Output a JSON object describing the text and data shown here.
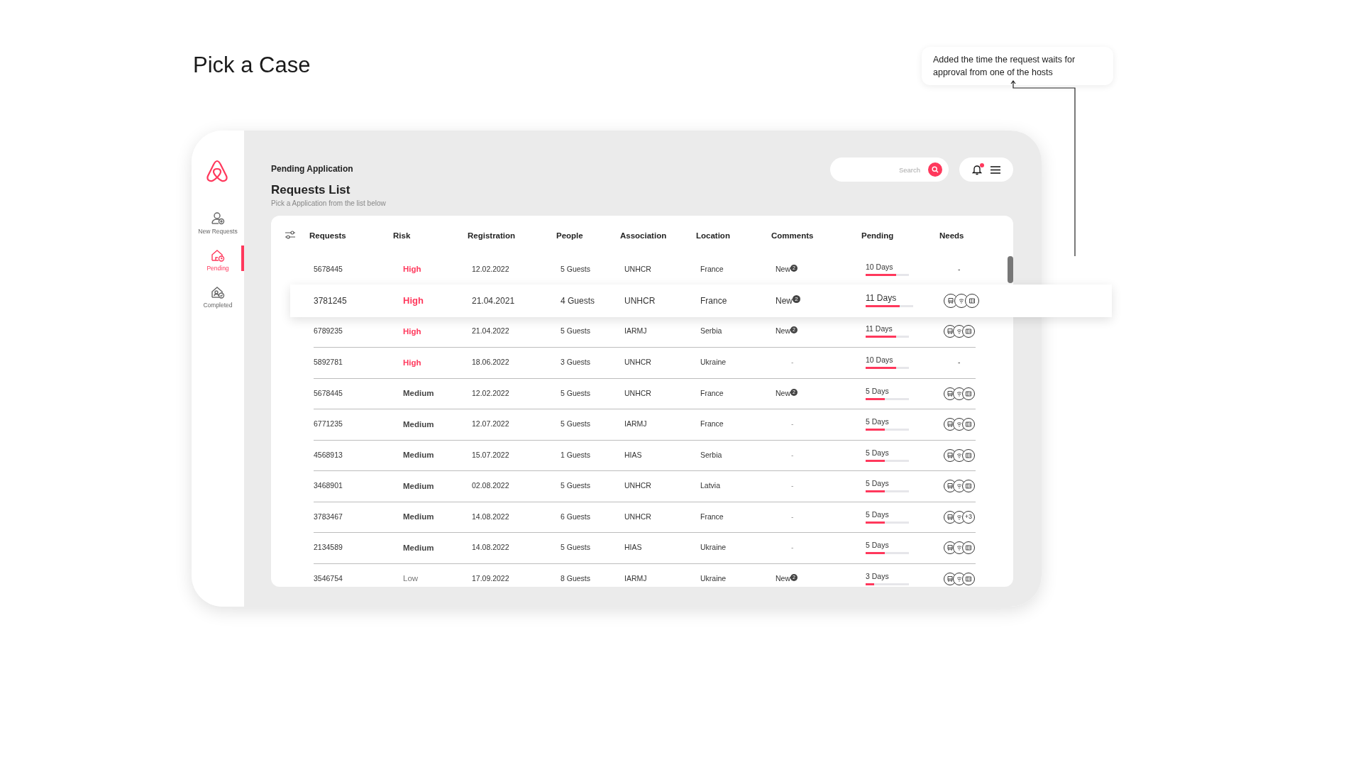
{
  "page_title": "Pick a Case",
  "annotation": {
    "text": "Added the time the request waits for approval from one of the hosts"
  },
  "sidebar": {
    "items": [
      {
        "label": "New Requests",
        "selected": false
      },
      {
        "label": "Pending",
        "selected": true
      },
      {
        "label": "Completed",
        "selected": false
      }
    ]
  },
  "header": {
    "eyebrow": "Pending Application",
    "title": "Requests List",
    "subtitle": "Pick a Application from the list below"
  },
  "search": {
    "placeholder": "Search"
  },
  "notifications": {
    "unread": true
  },
  "table": {
    "columns": [
      "Requests",
      "Risk",
      "Registration",
      "People",
      "Association",
      "Location",
      "Comments",
      "Pending",
      "Needs"
    ],
    "rows": [
      {
        "request": "5678445",
        "risk": "High",
        "color": "#ff385c",
        "risk_bold": true,
        "registration": "12.02.2022",
        "people": "5 Guests",
        "association": "UNHCR",
        "location": "France",
        "comment": "New",
        "comment_badge": "2",
        "pending": "10 Days",
        "level": 0.7,
        "needs_text": "-",
        "selected": false
      },
      {
        "request": "3781245",
        "risk": "High",
        "color": "#ff385c",
        "risk_bold": true,
        "registration": "21.04.2021",
        "people": "4 Guests",
        "association": "UNHCR",
        "location": "France",
        "comment": "New",
        "comment_badge": "2",
        "pending": "11 Days",
        "level": 0.72,
        "needs": [
          {
            "kind": "seat"
          },
          {
            "kind": "wifi"
          },
          {
            "kind": "card"
          }
        ],
        "selected": true
      },
      {
        "request": "6789235",
        "risk": "High",
        "color": "#ff385c",
        "risk_bold": true,
        "registration": "21.04.2022",
        "people": "5 Guests",
        "association": "IARMJ",
        "location": "Serbia",
        "comment": "New",
        "comment_badge": "2",
        "pending": "11 Days",
        "level": 0.71,
        "needs": [
          {
            "kind": "seat"
          },
          {
            "kind": "wifi"
          },
          {
            "kind": "card"
          }
        ],
        "selected": false
      },
      {
        "request": "5892781",
        "risk": "High",
        "color": "#ff385c",
        "risk_bold": true,
        "registration": "18.06.2022",
        "people": "3 Guests",
        "association": "UNHCR",
        "location": "Ukraine",
        "comment": "-",
        "pending": "10 Days",
        "level": 0.7,
        "needs_text": "-",
        "selected": false
      },
      {
        "request": "5678445",
        "risk": "Medium",
        "color": "#444444",
        "risk_bold": true,
        "registration": "12.02.2022",
        "people": "5 Guests",
        "association": "UNHCR",
        "location": "France",
        "comment": "New",
        "comment_badge": "2",
        "pending": "5 Days",
        "level": 0.44,
        "needs": [
          {
            "kind": "seat"
          },
          {
            "kind": "wifi"
          },
          {
            "kind": "card"
          }
        ],
        "selected": false
      },
      {
        "request": "6771235",
        "risk": "Medium",
        "color": "#444444",
        "risk_bold": true,
        "registration": "12.07.2022",
        "people": "5 Guests",
        "association": "IARMJ",
        "location": "France",
        "comment": "-",
        "pending": "5 Days",
        "level": 0.44,
        "needs": [
          {
            "kind": "seat"
          },
          {
            "kind": "wifi"
          },
          {
            "kind": "card"
          }
        ],
        "selected": false
      },
      {
        "request": "4568913",
        "risk": "Medium",
        "color": "#444444",
        "risk_bold": true,
        "registration": "15.07.2022",
        "people": "1 Guests",
        "association": "HIAS",
        "location": "Serbia",
        "comment": "-",
        "pending": "5 Days",
        "level": 0.44,
        "needs": [
          {
            "kind": "seat"
          },
          {
            "kind": "wifi"
          },
          {
            "kind": "card"
          }
        ],
        "selected": false
      },
      {
        "request": "3468901",
        "risk": "Medium",
        "color": "#444444",
        "risk_bold": true,
        "registration": "02.08.2022",
        "people": "5 Guests",
        "association": "UNHCR",
        "location": "Latvia",
        "comment": "-",
        "pending": "5 Days",
        "level": 0.44,
        "needs": [
          {
            "kind": "seat"
          },
          {
            "kind": "wifi"
          },
          {
            "kind": "card"
          }
        ],
        "selected": false
      },
      {
        "request": "3783467",
        "risk": "Medium",
        "color": "#444444",
        "risk_bold": true,
        "registration": "14.08.2022",
        "people": "6 Guests",
        "association": "UNHCR",
        "location": "France",
        "comment": "-",
        "pending": "5 Days",
        "level": 0.44,
        "needs": [
          {
            "kind": "seat"
          },
          {
            "kind": "wifi"
          },
          {
            "kind": "more",
            "label": "+3"
          }
        ],
        "selected": false
      },
      {
        "request": "2134589",
        "risk": "Medium",
        "color": "#444444",
        "risk_bold": true,
        "registration": "14.08.2022",
        "people": "5 Guests",
        "association": "HIAS",
        "location": "Ukraine",
        "comment": "-",
        "pending": "5 Days",
        "level": 0.44,
        "needs": [
          {
            "kind": "seat"
          },
          {
            "kind": "wifi"
          },
          {
            "kind": "card"
          }
        ],
        "selected": false
      },
      {
        "request": "3546754",
        "risk": "Low",
        "color": "#777777",
        "risk_bold": false,
        "registration": "17.09.2022",
        "people": "8 Guests",
        "association": "IARMJ",
        "location": "Ukraine",
        "comment": "New",
        "comment_badge": "2",
        "pending": "3 Days",
        "level": 0.2,
        "needs": [
          {
            "kind": "seat"
          },
          {
            "kind": "wifi"
          },
          {
            "kind": "card"
          }
        ],
        "selected": false
      }
    ]
  }
}
